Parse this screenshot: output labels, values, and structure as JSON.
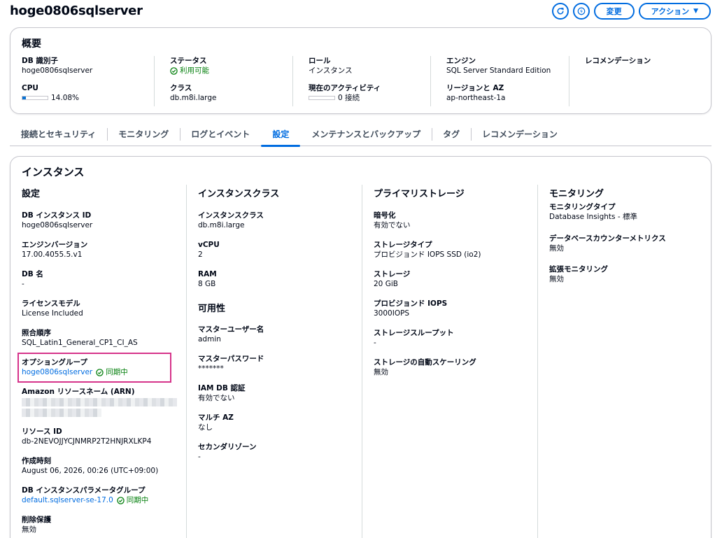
{
  "header": {
    "title": "hoge0806sqlserver",
    "refresh_icon": "refresh-icon",
    "bolt_icon": "lightning-icon",
    "modify_label": "変更",
    "actions_label": "アクション",
    "actions_caret": "▼"
  },
  "summary": {
    "title": "概要",
    "db_id_label": "DB 識別子",
    "db_id_value": "hoge0806sqlserver",
    "cpu_label": "CPU",
    "cpu_value": "14.08%",
    "cpu_fraction": 0.1408,
    "status_label": "ステータス",
    "status_value": "利用可能",
    "class_label": "クラス",
    "class_value": "db.m8i.large",
    "role_label": "ロール",
    "role_value": "インスタンス",
    "activity_label": "現在のアクティビティ",
    "activity_value": "0 接続",
    "activity_fraction": 0,
    "engine_label": "エンジン",
    "engine_value": "SQL Server Standard Edition",
    "region_label": "リージョンと AZ",
    "region_value": "ap-northeast-1a",
    "recommend_label": "レコメンデーション"
  },
  "tabs": [
    {
      "label": "接続とセキュリティ"
    },
    {
      "label": "モニタリング"
    },
    {
      "label": "ログとイベント"
    },
    {
      "label": "設定"
    },
    {
      "label": "メンテナンスとバックアップ"
    },
    {
      "label": "タグ"
    },
    {
      "label": "レコメンデーション"
    }
  ],
  "active_tab": "設定",
  "instance": {
    "title": "インスタンス",
    "settings": {
      "title": "設定",
      "instance_id_label": "DB インスタンス ID",
      "instance_id_value": "hoge0806sqlserver",
      "engine_version_label": "エンジンバージョン",
      "engine_version_value": "17.00.4055.5.v1",
      "db_name_label": "DB 名",
      "db_name_value": "-",
      "license_label": "ライセンスモデル",
      "license_value": "License Included",
      "collation_label": "照合順序",
      "collation_value": "SQL_Latin1_General_CP1_CI_AS",
      "option_group_label": "オプショングループ",
      "option_group_value": "hoge0806sqlserver",
      "option_group_status": "同期中",
      "arn_label": "Amazon リソースネーム (ARN)",
      "resource_id_label": "リソース ID",
      "resource_id_value": "db-2NEVOJJYCJNMRP2T2HNJRXLKP4",
      "created_label": "作成時刻",
      "created_value": "August 06, 2026, 00:26 (UTC+09:00)",
      "param_group_label": "DB インスタンスパラメータグループ",
      "param_group_value": "default.sqlserver-se-17.0",
      "param_group_status": "同期中",
      "deletion_label": "削除保護",
      "deletion_value": "無効"
    },
    "instance_class": {
      "title": "インスタンスクラス",
      "class_label": "インスタンスクラス",
      "class_value": "db.m8i.large",
      "vcpu_label": "vCPU",
      "vcpu_value": "2",
      "ram_label": "RAM",
      "ram_value": "8 GB"
    },
    "availability": {
      "title": "可用性",
      "master_user_label": "マスターユーザー名",
      "master_user_value": "admin",
      "master_pw_label": "マスターパスワード",
      "master_pw_value": "*******",
      "iam_label": "IAM DB 認証",
      "iam_value": "有効でない",
      "multi_az_label": "マルチ AZ",
      "multi_az_value": "なし",
      "secondary_zone_label": "セカンダリゾーン",
      "secondary_zone_value": "-"
    },
    "storage": {
      "title": "プライマリストレージ",
      "encryption_label": "暗号化",
      "encryption_value": "有効でない",
      "type_label": "ストレージタイプ",
      "type_value": "プロビジョンド IOPS SSD (io2)",
      "size_label": "ストレージ",
      "size_value": "20 GiB",
      "iops_label": "プロビジョンド IOPS",
      "iops_value": "3000IOPS",
      "throughput_label": "ストレージスループット",
      "throughput_value": "-",
      "autoscaling_label": "ストレージの自動スケーリング",
      "autoscaling_value": "無効"
    },
    "monitoring": {
      "title": "モニタリング",
      "type_label": "モニタリングタイプ",
      "type_value": "Database Insights - 標準",
      "counter_label": "データベースカウンターメトリクス",
      "counter_value": "無効",
      "enhanced_label": "拡張モニタリング",
      "enhanced_value": "無効"
    }
  },
  "colors": {
    "accent": "#006ce0",
    "success": "#037f0c",
    "highlight": "#d6338a"
  }
}
